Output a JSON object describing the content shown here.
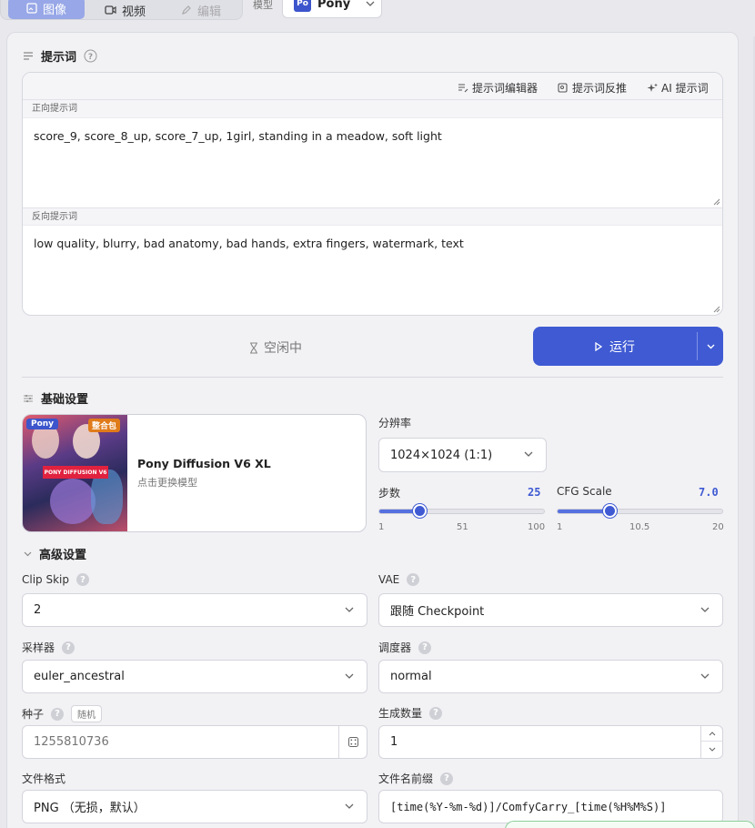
{
  "tabs": {
    "image": "图像",
    "video": "视频",
    "edit": "编辑"
  },
  "model": {
    "label": "模型",
    "badge": "Po",
    "value": "Pony"
  },
  "prompt": {
    "title": "提示词",
    "tools": {
      "editor": "提示词编辑器",
      "reverse": "提示词反推",
      "ai": "AI 提示词"
    },
    "positive_label": "正向提示词",
    "positive": "score_9, score_8_up, score_7_up, 1girl, standing in a meadow, soft light",
    "negative_label": "反向提示词",
    "negative": "low quality, blurry, bad anatomy, bad hands, extra fingers, watermark, text"
  },
  "run": {
    "status": "空闲中",
    "button": "运行"
  },
  "basic": {
    "title": "基础设置",
    "card": {
      "tag_left": "Pony",
      "tag_right": "整合包",
      "banner": "PONY DIFFUSION V6",
      "name": "Pony Diffusion V6 XL",
      "hint": "点击更换模型"
    },
    "resolution_label": "分辨率",
    "resolution": "1024×1024 (1:1)",
    "steps": {
      "label": "步数",
      "value": "25",
      "min": "1",
      "mid": "51",
      "max": "100",
      "fraction": 0.242
    },
    "cfg": {
      "label": "CFG Scale",
      "value": "7.0",
      "min": "1",
      "mid": "10.5",
      "max": "20",
      "fraction": 0.316
    }
  },
  "advanced": {
    "title": "高级设置",
    "clip_label": "Clip Skip",
    "clip": "2",
    "vae_label": "VAE",
    "vae": "跟随 Checkpoint",
    "sampler_label": "采样器",
    "sampler": "euler_ancestral",
    "scheduler_label": "调度器",
    "scheduler": "normal",
    "seed_label": "种子",
    "seed_random": "随机",
    "seed_placeholder": "1255810736",
    "count_label": "生成数量",
    "count": "1",
    "format_label": "文件格式",
    "format": "PNG （无损，默认）",
    "prefix_label": "文件名前缀",
    "prefix": "[time(%Y-%m-%d)]/ComfyCarry_[time(%H%M%S)]"
  },
  "colors": {
    "accent": "#3f5ad3",
    "panel": "#f2f2f5"
  }
}
